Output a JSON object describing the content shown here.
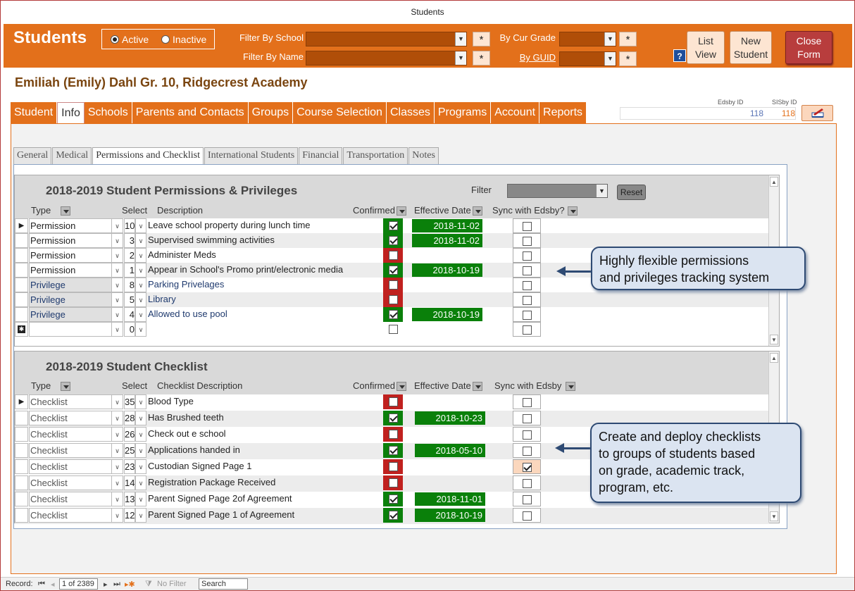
{
  "window": {
    "title": "Students"
  },
  "header": {
    "app_title": "Students",
    "radio_active": "Active",
    "radio_inactive": "Inactive",
    "filter_school_label": "Filter By School",
    "filter_name_label": "Filter By Name",
    "cur_grade_label": "By Cur Grade",
    "guid_label": "By GUID",
    "star": "*",
    "help": "?",
    "list_view": [
      "List",
      "View"
    ],
    "new_student": [
      "New",
      "Student"
    ],
    "close_form": [
      "Close",
      "Form"
    ]
  },
  "student": {
    "name": "Emiliah (Emily)  Dahl  Gr. 10, Ridgecrest Academy",
    "edsby_id_label": "Edsby ID",
    "sis_id_label": "SISby ID",
    "edsby_id": "118",
    "sis_id": "118"
  },
  "main_tabs": [
    "Student",
    "Info",
    "Schools",
    "Parents and Contacts",
    "Groups",
    "Course Selection",
    "Classes",
    "Programs",
    "Account",
    "Reports"
  ],
  "sub_tabs": [
    "General",
    "Medical",
    "Permissions and Checklist",
    "International Students",
    "Financial",
    "Transportation",
    "Notes"
  ],
  "permissions": {
    "title": "2018-2019 Student Permissions & Privileges",
    "filter_label": "Filter",
    "reset_label": "Reset",
    "col_type": "Type",
    "col_select": "Select",
    "col_desc": "Description",
    "col_confirmed": "Confirmed",
    "col_date": "Effective Date",
    "col_sync": "Sync with Edsby?",
    "rows": [
      {
        "type": "Permission",
        "num": "10",
        "desc": "Leave school property during lunch time",
        "confirmed": true,
        "date": "2018-11-02",
        "sync": false
      },
      {
        "type": "Permission",
        "num": "3",
        "desc": "Supervised swimming activities",
        "confirmed": true,
        "date": "2018-11-02",
        "sync": false
      },
      {
        "type": "Permission",
        "num": "2",
        "desc": "Administer Meds",
        "confirmed": false,
        "date": "",
        "sync": false
      },
      {
        "type": "Permission",
        "num": "1",
        "desc": "Appear in School's Promo print/electronic media",
        "confirmed": true,
        "date": "2018-10-19",
        "sync": false
      },
      {
        "type": "Privilege",
        "num": "8",
        "desc": "Parking Privelages",
        "confirmed": false,
        "date": "",
        "sync": false
      },
      {
        "type": "Privilege",
        "num": "5",
        "desc": "Library",
        "confirmed": false,
        "date": "",
        "sync": false
      },
      {
        "type": "Privilege",
        "num": "4",
        "desc": "Allowed to use pool",
        "confirmed": true,
        "date": "2018-10-19",
        "sync": false
      }
    ],
    "new_row_num": "0"
  },
  "checklist": {
    "title": "2018-2019 Student Checklist",
    "col_type": "Type",
    "col_select": "Select",
    "col_desc": "Checklist Description",
    "col_confirmed": "Confirmed",
    "col_date": "Effective Date",
    "col_sync": "Sync with Edsby",
    "rows": [
      {
        "type": "Checklist",
        "num": "35",
        "desc": "Blood Type",
        "confirmed": false,
        "date": "",
        "sync": false
      },
      {
        "type": "Checklist",
        "num": "28",
        "desc": "Has Brushed teeth",
        "confirmed": true,
        "date": "2018-10-23",
        "sync": false
      },
      {
        "type": "Checklist",
        "num": "26",
        "desc": "Check out e school",
        "confirmed": false,
        "date": "",
        "sync": false
      },
      {
        "type": "Checklist",
        "num": "25",
        "desc": "Applications handed in",
        "confirmed": true,
        "date": "2018-05-10",
        "sync": false
      },
      {
        "type": "Checklist",
        "num": "23",
        "desc": "Custodian Signed Page 1",
        "confirmed": false,
        "date": "",
        "sync": true
      },
      {
        "type": "Checklist",
        "num": "14",
        "desc": "Registration Package Received",
        "confirmed": false,
        "date": "",
        "sync": false
      },
      {
        "type": "Checklist",
        "num": "13",
        "desc": "Parent Signed Page 2of Agreement",
        "confirmed": true,
        "date": "2018-11-01",
        "sync": false
      },
      {
        "type": "Checklist",
        "num": "12",
        "desc": "Parent Signed Page 1 of Agreement",
        "confirmed": true,
        "date": "2018-10-19",
        "sync": false
      }
    ]
  },
  "callouts": {
    "permissions": [
      "Highly flexible permissions",
      "and privileges tracking system"
    ],
    "checklist": [
      "Create and deploy checklists",
      "to groups of students based",
      "on grade, academic track,",
      "program, etc."
    ]
  },
  "record_bar": {
    "label": "Record:",
    "current": "1 of 2389",
    "no_filter": "No Filter",
    "search": "Search"
  },
  "colors": {
    "accent": "#e3701b",
    "confirmed_green": "#0a800a",
    "unconfirmed_red": "#c0211f",
    "callout_border": "#2e4a73"
  }
}
